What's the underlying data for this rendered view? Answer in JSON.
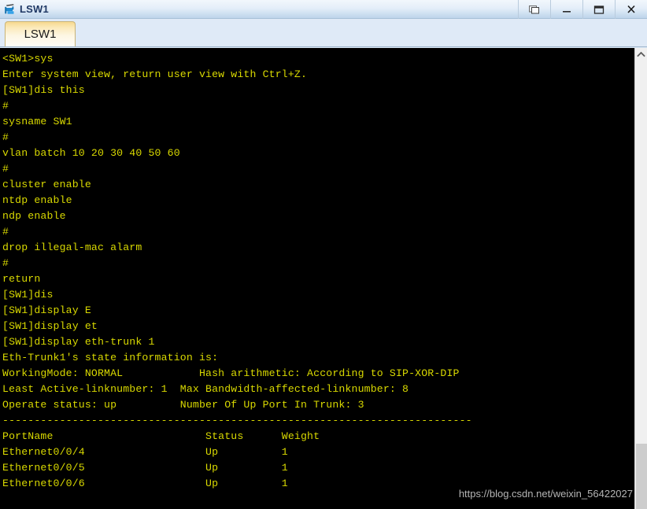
{
  "window": {
    "title": "LSW1",
    "icon": "switch-device-icon",
    "controls": [
      {
        "name": "restore-window-button",
        "glyph": "restore"
      },
      {
        "name": "minimize-window-button",
        "glyph": "minimize"
      },
      {
        "name": "maximize-window-button",
        "glyph": "maximize"
      },
      {
        "name": "close-window-button",
        "glyph": "close"
      }
    ]
  },
  "tabs": [
    {
      "label": "LSW1",
      "active": true
    }
  ],
  "terminal": {
    "foreground_color": "#d9d900",
    "background_color": "#000000",
    "lines": [
      "<SW1>sys",
      "Enter system view, return user view with Ctrl+Z.",
      "[SW1]dis this",
      "#",
      "sysname SW1",
      "#",
      "vlan batch 10 20 30 40 50 60",
      "#",
      "cluster enable",
      "ntdp enable",
      "ndp enable",
      "#",
      "drop illegal-mac alarm",
      "#",
      "return",
      "[SW1]dis",
      "[SW1]display E",
      "[SW1]display et",
      "[SW1]display eth-trunk 1",
      "Eth-Trunk1's state information is:",
      "WorkingMode: NORMAL            Hash arithmetic: According to SIP-XOR-DIP",
      "Least Active-linknumber: 1  Max Bandwidth-affected-linknumber: 8",
      "Operate status: up          Number Of Up Port In Trunk: 3",
      "--------------------------------------------------------------------------",
      "PortName                        Status      Weight",
      "Ethernet0/0/4                   Up          1",
      "Ethernet0/0/5                   Up          1",
      "Ethernet0/0/6                   Up          1"
    ]
  },
  "scrollbar": {
    "up_arrow": "chevron-up-icon"
  },
  "watermark": {
    "text": "https://blog.csdn.net/weixin_56422027"
  }
}
